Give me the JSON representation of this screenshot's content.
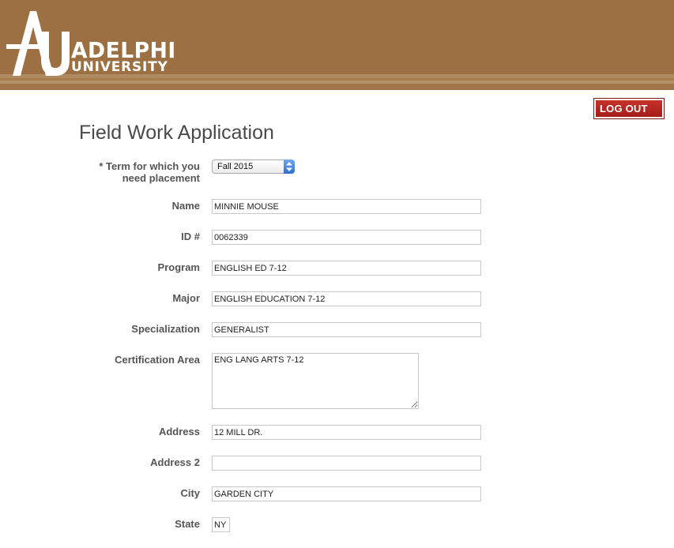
{
  "header": {
    "logo_line1": "ADELPHI",
    "logo_line2": "UNIVERSITY",
    "logo_mark_icon": "adelphi-au-monogram-icon",
    "background_color": "#9c7042"
  },
  "logout": {
    "label": "LOG OUT",
    "color": "#b3231d"
  },
  "form": {
    "title": "Field Work Application",
    "term": {
      "label_line1": "* Term for which you",
      "label_line2": "need placement",
      "selected": "Fall 2015"
    },
    "name": {
      "label": "Name",
      "value": "MINNIE MOUSE"
    },
    "id": {
      "label": "ID #",
      "value": "0062339"
    },
    "program": {
      "label": "Program",
      "value": "ENGLISH ED 7-12"
    },
    "major": {
      "label": "Major",
      "value": "ENGLISH EDUCATION 7-12"
    },
    "specialization": {
      "label": "Specialization",
      "value": "GENERALIST"
    },
    "certification": {
      "label": "Certification Area",
      "value": "ENG LANG ARTS 7-12"
    },
    "address": {
      "label": "Address",
      "value": "12 MILL DR."
    },
    "address2": {
      "label": "Address 2",
      "value": ""
    },
    "city": {
      "label": "City",
      "value": "GARDEN CITY"
    },
    "state": {
      "label": "State",
      "value": "NY"
    }
  }
}
